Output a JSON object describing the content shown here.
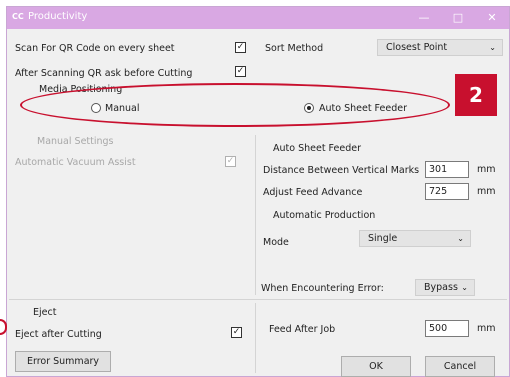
{
  "window": {
    "icon_text": "CC",
    "title": "Productivity",
    "minimize": "—",
    "maximize": "□",
    "close": "✕"
  },
  "left": {
    "scan_qr_label": "Scan For QR Code on every sheet",
    "scan_qr_checked": true,
    "ask_before_cutting_label": "After Scanning QR ask before Cutting",
    "ask_before_cutting_checked": true,
    "media_positioning_title": "Media Positioning",
    "manual_label": "Manual",
    "manual_settings_title": "Manual Settings",
    "auto_vacuum_label": "Automatic Vacuum Assist",
    "auto_vacuum_checked": true,
    "eject_title": "Eject",
    "eject_after_cutting_label": "Eject after Cutting",
    "eject_after_cutting_checked": true,
    "error_summary_button": "Error Summary"
  },
  "right": {
    "sort_method_label": "Sort Method",
    "sort_method_value": "Closest Point",
    "auto_sheet_feeder_radio_label": "Auto Sheet Feeder",
    "media_positioning_selected": "Auto Sheet Feeder",
    "auto_sheet_feeder_title": "Auto Sheet Feeder",
    "distance_label": "Distance Between Vertical Marks",
    "distance_value": "301",
    "distance_unit": "mm",
    "adjust_feed_label": "Adjust Feed Advance",
    "adjust_feed_value": "725",
    "adjust_feed_unit": "mm",
    "auto_production_title": "Automatic Production",
    "mode_label": "Mode",
    "mode_value": "Single",
    "error_label": "When Encountering Error:",
    "error_value": "Bypass",
    "feed_after_job_label": "Feed After Job",
    "feed_after_job_value": "500",
    "feed_after_job_unit": "mm",
    "ok_button": "OK",
    "cancel_button": "Cancel"
  },
  "annotation": {
    "callout_number": "2",
    "color": "#c8102e"
  },
  "icons": {
    "check": "check-icon",
    "chevron": "chevron-down-icon"
  }
}
